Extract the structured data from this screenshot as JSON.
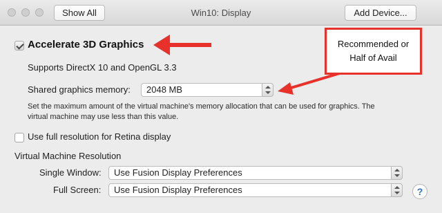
{
  "window": {
    "title": "Win10: Display",
    "show_all_label": "Show All",
    "add_device_label": "Add Device..."
  },
  "graphics": {
    "accelerate_label": "Accelerate 3D Graphics",
    "accelerate_checked": true,
    "supports_text": "Supports DirectX 10 and OpenGL 3.3",
    "shared_memory_label": "Shared graphics memory:",
    "shared_memory_value": "2048 MB",
    "description_line1": "Set the maximum amount of the virtual machine's memory allocation that can be used for graphics. The",
    "description_line2": "virtual machine may use less than this value."
  },
  "retina": {
    "label": "Use full resolution for Retina display",
    "checked": false
  },
  "resolution": {
    "section_label": "Virtual Machine Resolution",
    "single_window_label": "Single Window:",
    "single_window_value": "Use Fusion Display Preferences",
    "full_screen_label": "Full Screen:",
    "full_screen_value": "Use Fusion Display Preferences"
  },
  "help_label": "?",
  "annotation": {
    "callout_text": "Recommended or\nHalf of Avail",
    "arrow_color": "#e8312a"
  }
}
